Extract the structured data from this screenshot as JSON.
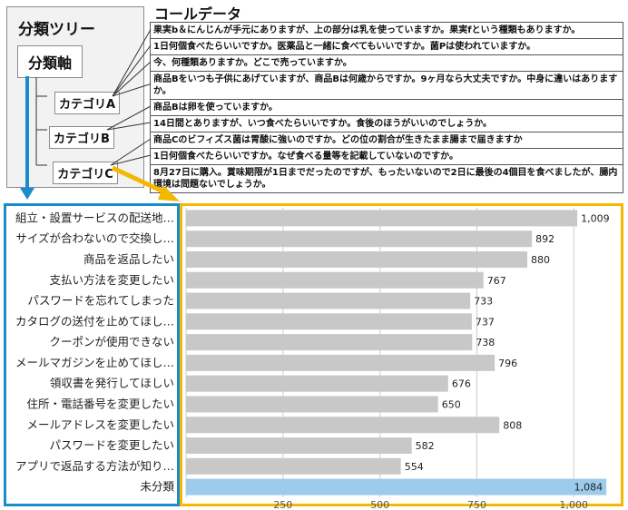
{
  "tree": {
    "title": "分類ツリー",
    "axis_label": "分類軸",
    "categories": [
      "カテゴリA",
      "カテゴリB",
      "カテゴリC"
    ]
  },
  "call_data": {
    "title": "コールデータ",
    "rows": [
      "果実b＆にんじんが手元にありますが、上の部分は乳を使っていますか。果実fという種類もありますか。",
      "1日何個食べたらいいですか。医薬品と一緒に食べてもいいですか。菌Pは使われていますか。",
      "今、何種類ありますか。どこで売っていますか。",
      "商品Bをいつも子供にあげていますが、商品Bは何歳からですか。9ヶ月なら大丈夫ですか。中身に違いはありますか。",
      "商品Bは卵を使っていますか。",
      "14日間とありますが、いつ食べたらいいですか。食後のほうがいいのでしょうか。",
      "商品Cのビフィズス菌は胃酸に強いのですか。どの位の割合が生きたまま腸まで届きますか",
      "1日何個食べたらいいですか。なぜ食べる量等を記載していないのですか。",
      "8月27日に購入。賞味期限が1日までだったのですが、もったいないので2日に最後の4個目を食べましたが、腸内環境は問題ないでしょうか。"
    ]
  },
  "colors": {
    "bar": "#c8c8c8",
    "bar_highlight": "#9ccbec",
    "left_border": "#1a8ccc",
    "chart_border": "#f5b800",
    "grid": "#cccccc"
  },
  "chart_data": {
    "type": "bar",
    "orientation": "horizontal",
    "categories": [
      "組立・設置サービスの配送地…",
      "サイズが合わないので交換し…",
      "商品を返品したい",
      "支払い方法を変更したい",
      "パスワードを忘れてしまった",
      "カタログの送付を止めてほし…",
      "クーポンが使用できない",
      "メールマガジンを止めてほし…",
      "領収書を発行してほしい",
      "住所・電話番号を変更したい",
      "メールアドレスを変更したい",
      "パスワードを変更したい",
      "アプリで返品する方法が知り…",
      "未分類"
    ],
    "values": [
      1009,
      892,
      880,
      767,
      733,
      737,
      738,
      796,
      676,
      650,
      808,
      582,
      554,
      1084
    ],
    "value_labels": [
      "1,009",
      "892",
      "880",
      "767",
      "733",
      "737",
      "738",
      "796",
      "676",
      "650",
      "808",
      "582",
      "554",
      "1,084"
    ],
    "highlight_index": 13,
    "xlim": [
      0,
      1100
    ],
    "xticks": [
      250,
      500,
      750,
      1000
    ],
    "xtick_labels": [
      "250",
      "500",
      "750",
      "1,000"
    ],
    "grid": true,
    "title": "",
    "xlabel": "",
    "ylabel": ""
  }
}
